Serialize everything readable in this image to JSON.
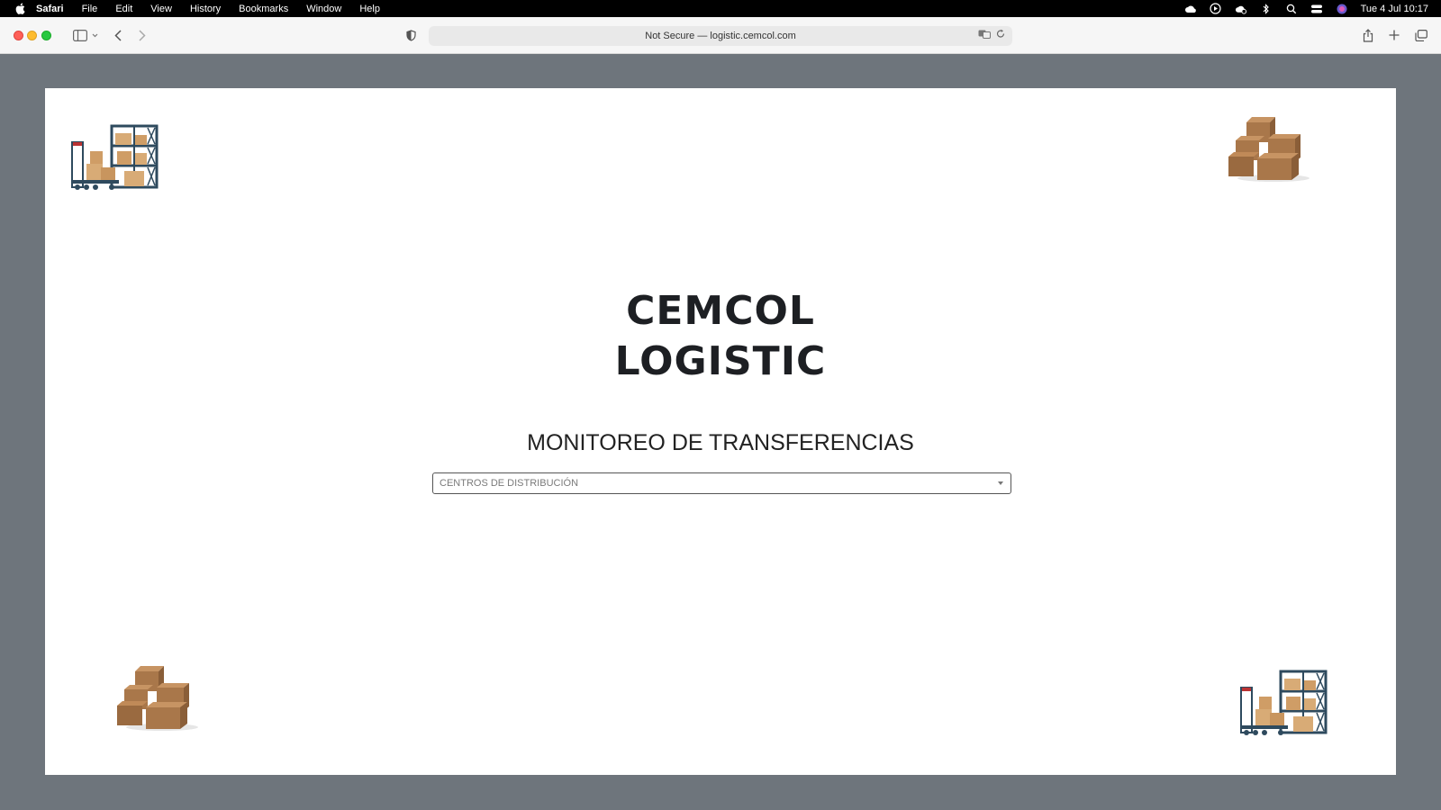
{
  "menubar": {
    "app_name": "Safari",
    "menus": [
      "File",
      "Edit",
      "View",
      "History",
      "Bookmarks",
      "Window",
      "Help"
    ],
    "datetime": "Tue 4 Jul  10:17"
  },
  "browser": {
    "url_text": "Not Secure — logistic.cemcol.com"
  },
  "page": {
    "brand_line1": "CEMCOL",
    "brand_line2": "LOGISTIC",
    "title": "MONITOREO DE TRANSFERENCIAS",
    "select": {
      "placeholder": "CENTROS DE DISTRIBUCIÓN"
    },
    "decorations": [
      "warehouse-shelf-icon",
      "box-pile-icon",
      "box-pile-icon",
      "warehouse-shelf-icon"
    ]
  },
  "colors": {
    "page_background": "#6e757c",
    "card_background": "#ffffff",
    "brand_text": "#1d1f23"
  }
}
